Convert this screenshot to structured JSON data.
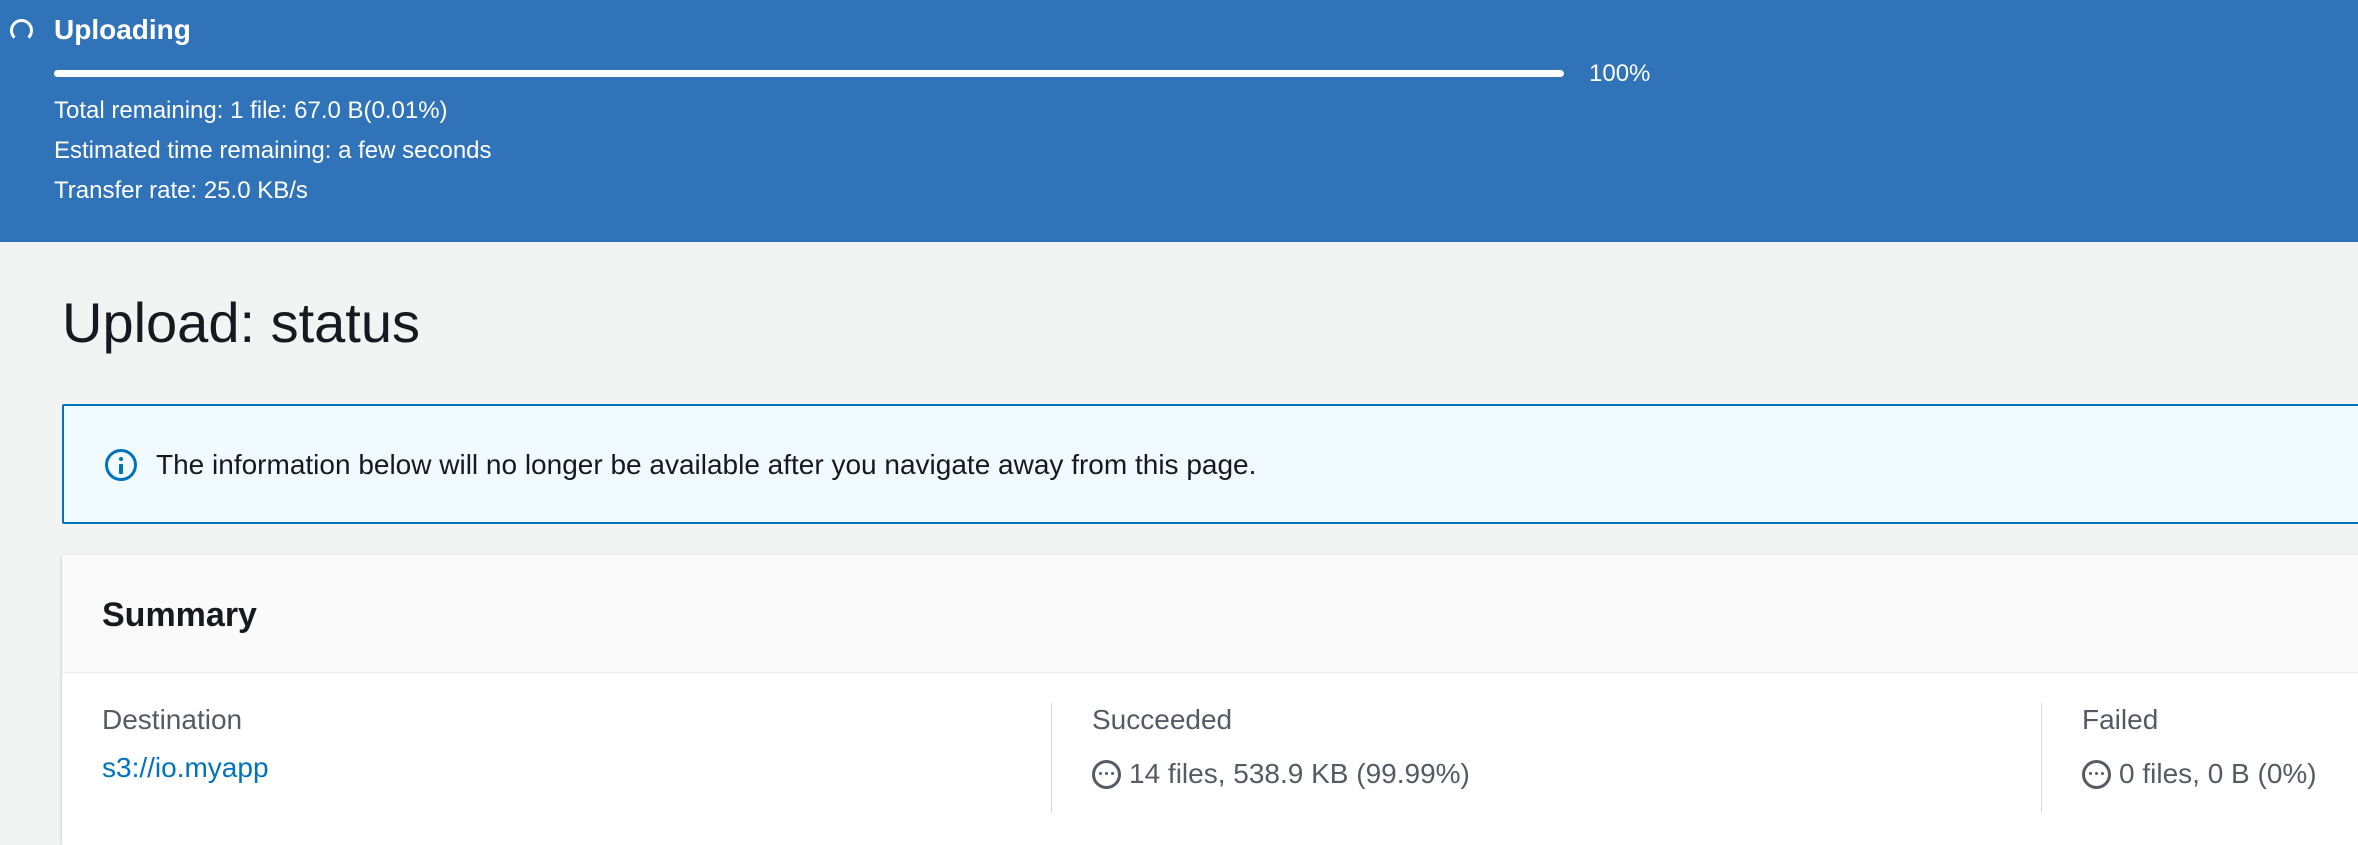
{
  "banner": {
    "title": "Uploading",
    "progress_percent": 100,
    "progress_label": "100%",
    "total_remaining": "Total remaining: 1 file: 67.0 B(0.01%)",
    "estimated_time": "Estimated time remaining: a few seconds",
    "transfer_rate": "Transfer rate: 25.0 KB/s",
    "background_color": "#3173b8"
  },
  "page": {
    "title": "Upload: status"
  },
  "info_alert": {
    "message": "The information below will no longer be available after you navigate away from this page.",
    "icon": "info-icon",
    "accent_color": "#0073bb"
  },
  "summary": {
    "title": "Summary",
    "destination": {
      "label": "Destination",
      "value": "s3://io.myapp"
    },
    "succeeded": {
      "label": "Succeeded",
      "icon": "in-progress-dots-icon",
      "value": "14 files, 538.9 KB (99.99%)"
    },
    "failed": {
      "label": "Failed",
      "icon": "in-progress-dots-icon",
      "value": "0 files, 0 B (0%)"
    }
  }
}
